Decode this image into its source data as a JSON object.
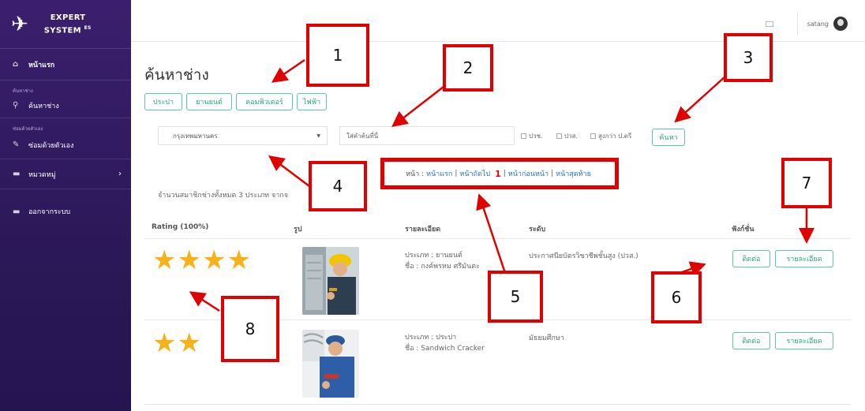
{
  "brand": {
    "line1": "EXPERT",
    "line2": "SYSTEM",
    "sup": "ES"
  },
  "sidebar": {
    "home": "หน้าแรก",
    "section1": "ค้นหาช่าง",
    "find_tech": "ค้นหาช่าง",
    "section2": "ซ่อมด้วยตัวเอง",
    "self_repair": "ซ่อมด้วยตัวเอง",
    "category": "หมวดหมู่",
    "logout": "ออกจากระบบ"
  },
  "topbar": {
    "user": "satang"
  },
  "page": {
    "title": "ค้นหาช่าง"
  },
  "categories": [
    "ประปา",
    "ยานยนต์",
    "คอมพิวเตอร์",
    "ไฟฟ้า"
  ],
  "search": {
    "province": "กรุงเทพมหานคร",
    "placeholder": "ใส่คำค้นที่นี่",
    "checks": [
      "ปวช.",
      "ปวส.",
      "สูงกว่า ป.ตรี"
    ],
    "button": "ค้นหา"
  },
  "pager": {
    "prefix": "หน้า :",
    "first": "หน้าแรก",
    "next": "หน้าถัดไป",
    "current": "1",
    "prev": "หน้าก่อนหน้า",
    "last": "หน้าสุดท้าย",
    "sep": "|"
  },
  "member_count": "จำนวนสมาชิกช่างทั้งหมด 3 ประเภท จากจ",
  "table": {
    "headers": [
      "Rating (100%)",
      "รูป",
      "รายละเอียด",
      "ระดับ",
      "ฟังก์ชั่น"
    ],
    "rows": [
      {
        "stars": "★★★★",
        "rating": 4,
        "type": "ประเภท : ยานยนต์",
        "name": "ชื่อ : กงค์พรหม ศรีมันตะ",
        "level": "ประกาศนียบัตรวิชาชีพชั้นสูง (ปวส.)",
        "contact": "ติดต่อ",
        "details": "รายละเอียด"
      },
      {
        "stars": "★★",
        "rating": 2,
        "type": "ประเภท : ประปา",
        "name": "ชื่อ : Sandwich Cracker",
        "level": "มัธยมศึกษา",
        "contact": "ติดต่อ",
        "details": "รายละเอียด"
      }
    ]
  },
  "annotations": [
    "1",
    "2",
    "3",
    "4",
    "5",
    "6",
    "7",
    "8"
  ],
  "colors": {
    "accent": "#2ba57f",
    "annotation": "#e00000",
    "star": "#f5b21d",
    "sidebar": "#2c1858"
  }
}
